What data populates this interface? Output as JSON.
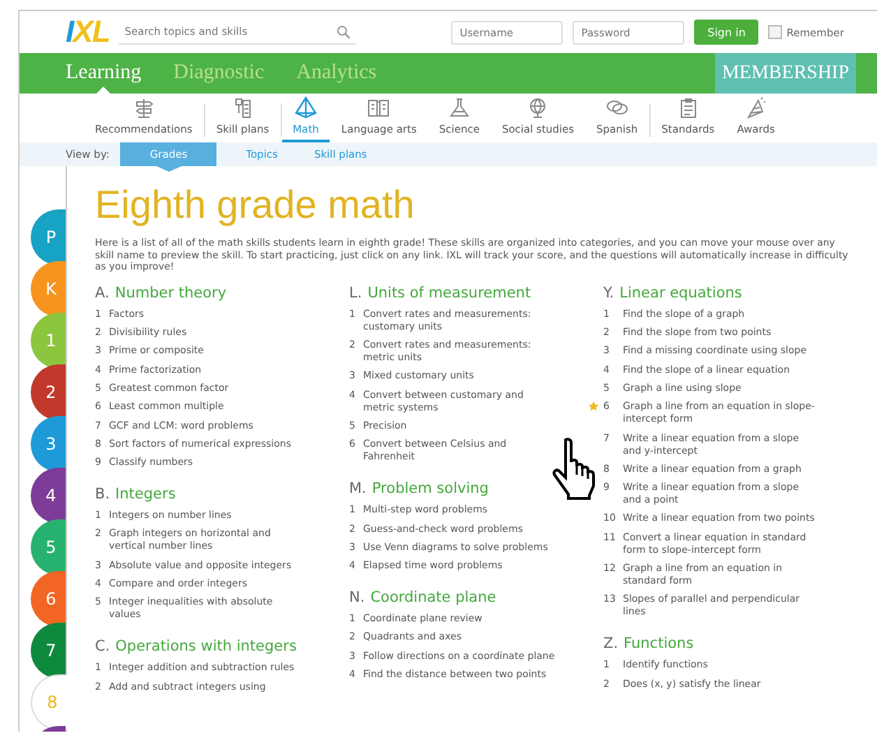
{
  "header": {
    "logo": "IXL",
    "search": {
      "placeholder": "Search topics and skills"
    },
    "username": {
      "placeholder": "Username"
    },
    "password": {
      "placeholder": "Password"
    },
    "sign_in": "Sign in",
    "remember": {
      "label": "Remember",
      "checked": false
    }
  },
  "main_nav": {
    "tabs": [
      {
        "label": "Learning",
        "selected": true
      },
      {
        "label": "Diagnostic",
        "selected": false
      },
      {
        "label": "Analytics",
        "selected": false
      }
    ],
    "membership": "MEMBERSHIP"
  },
  "subject_nav": [
    {
      "label": "Recommendations",
      "selected": false
    },
    {
      "label": "Skill plans",
      "selected": false
    },
    {
      "label": "Math",
      "selected": true
    },
    {
      "label": "Language arts",
      "selected": false
    },
    {
      "label": "Science",
      "selected": false
    },
    {
      "label": "Social studies",
      "selected": false
    },
    {
      "label": "Spanish",
      "selected": false
    },
    {
      "label": "Standards",
      "selected": false
    },
    {
      "label": "Awards",
      "selected": false
    }
  ],
  "view_by": {
    "label": "View by:",
    "tabs": [
      {
        "label": "Grades",
        "selected": true
      },
      {
        "label": "Topics",
        "selected": false
      },
      {
        "label": "Skill plans",
        "selected": false
      }
    ]
  },
  "grades": [
    {
      "label": "P",
      "color": "#16a3c4",
      "selected": false
    },
    {
      "label": "K",
      "color": "#f7941d",
      "selected": false
    },
    {
      "label": "1",
      "color": "#8cc63e",
      "selected": false
    },
    {
      "label": "2",
      "color": "#c0392b",
      "selected": false
    },
    {
      "label": "3",
      "color": "#1e9ad8",
      "selected": false
    },
    {
      "label": "4",
      "color": "#7d3c98",
      "selected": false
    },
    {
      "label": "5",
      "color": "#27b36f",
      "selected": false
    },
    {
      "label": "6",
      "color": "#f26522",
      "selected": false
    },
    {
      "label": "7",
      "color": "#0e8a3e",
      "selected": false
    },
    {
      "label": "8",
      "color": "#f2b81c",
      "selected": true
    },
    {
      "color": "#7d3c98",
      "selected": false
    }
  ],
  "title": "Eighth grade math",
  "description": "Here is a list of all of the math skills students learn in eighth grade! These skills are organized into categories, and you can move your mouse over any skill name to preview the skill. To start practicing, just click on any link. IXL will track your score, and the questions will automatically increase in difficulty as you improve!",
  "columns": [
    [
      {
        "letter": "A.",
        "title": "Number theory",
        "items": [
          {
            "number": "1",
            "text": "Factors"
          },
          {
            "number": "2",
            "text": "Divisibility rules"
          },
          {
            "number": "3",
            "text": "Prime or composite"
          },
          {
            "number": "4",
            "text": "Prime factorization"
          },
          {
            "number": "5",
            "text": "Greatest common factor"
          },
          {
            "number": "6",
            "text": "Least common multiple"
          },
          {
            "number": "7",
            "text": "GCF and LCM: word problems"
          },
          {
            "number": "8",
            "text": "Sort factors of numerical expressions"
          },
          {
            "number": "9",
            "text": "Classify numbers"
          }
        ]
      },
      {
        "letter": "B.",
        "title": "Integers",
        "items": [
          {
            "number": "1",
            "text": "Integers on number lines"
          },
          {
            "number": "2",
            "text": "Graph integers on horizontal and vertical number lines"
          },
          {
            "number": "3",
            "text": "Absolute value and opposite integers"
          },
          {
            "number": "4",
            "text": "Compare and order integers"
          },
          {
            "number": "5",
            "text": "Integer inequalities with absolute values"
          }
        ]
      },
      {
        "letter": "C.",
        "title": "Operations with integers",
        "items": [
          {
            "number": "1",
            "text": "Integer addition and subtraction rules"
          },
          {
            "number": "2",
            "text": "Add and subtract integers using"
          }
        ]
      }
    ],
    [
      {
        "letter": "L.",
        "title": "Units of measurement",
        "items": [
          {
            "number": "1",
            "text": "Convert rates and measurements: customary units"
          },
          {
            "number": "2",
            "text": "Convert rates and measurements: metric units"
          },
          {
            "number": "3",
            "text": "Mixed customary units"
          },
          {
            "number": "4",
            "text": "Convert between customary and metric systems"
          },
          {
            "number": "5",
            "text": "Precision"
          },
          {
            "number": "6",
            "text": "Convert between Celsius and Fahrenheit"
          }
        ]
      },
      {
        "letter": "M.",
        "title": "Problem solving",
        "items": [
          {
            "number": "1",
            "text": "Multi-step word problems"
          },
          {
            "number": "2",
            "text": "Guess-and-check word problems"
          },
          {
            "number": "3",
            "text": "Use Venn diagrams to solve problems"
          },
          {
            "number": "4",
            "text": "Elapsed time word problems"
          }
        ]
      },
      {
        "letter": "N.",
        "title": "Coordinate plane",
        "items": [
          {
            "number": "1",
            "text": "Coordinate plane review"
          },
          {
            "number": "2",
            "text": "Quadrants and axes"
          },
          {
            "number": "3",
            "text": "Follow directions on a coordinate plane"
          },
          {
            "number": "4",
            "text": "Find the distance between two points"
          }
        ]
      }
    ],
    [
      {
        "letter": "Y.",
        "title": "Linear equations",
        "items": [
          {
            "number": "1",
            "text": "Find the slope of a graph",
            "starred": false
          },
          {
            "number": "2",
            "text": "Find the slope from two points",
            "starred": false
          },
          {
            "number": "3",
            "text": "Find a missing coordinate using slope",
            "starred": false
          },
          {
            "number": "4",
            "text": "Find the slope of a linear equation",
            "starred": false
          },
          {
            "number": "5",
            "text": "Graph a line using slope",
            "starred": false
          },
          {
            "number": "6",
            "text": "Graph a line from an equation in slope-intercept form",
            "starred": true
          },
          {
            "number": "7",
            "text": "Write a linear equation from a slope and y-intercept",
            "starred": false
          },
          {
            "number": "8",
            "text": "Write a linear equation from a graph",
            "starred": false
          },
          {
            "number": "9",
            "text": "Write a linear equation from a slope and a point",
            "starred": false
          },
          {
            "number": "10",
            "text": "Write a linear equation from two points",
            "starred": false
          },
          {
            "number": "11",
            "text": "Convert a linear equation in standard form to slope-intercept form",
            "starred": false
          },
          {
            "number": "12",
            "text": "Graph a line from an equation in standard form",
            "starred": false
          },
          {
            "number": "13",
            "text": "Slopes of parallel and perpendicular lines",
            "starred": false
          }
        ]
      },
      {
        "letter": "Z.",
        "title": "Functions",
        "items": [
          {
            "number": "1",
            "text": "Identify functions"
          },
          {
            "number": "2",
            "text": "Does (x, y) satisfy the linear"
          }
        ]
      }
    ]
  ]
}
